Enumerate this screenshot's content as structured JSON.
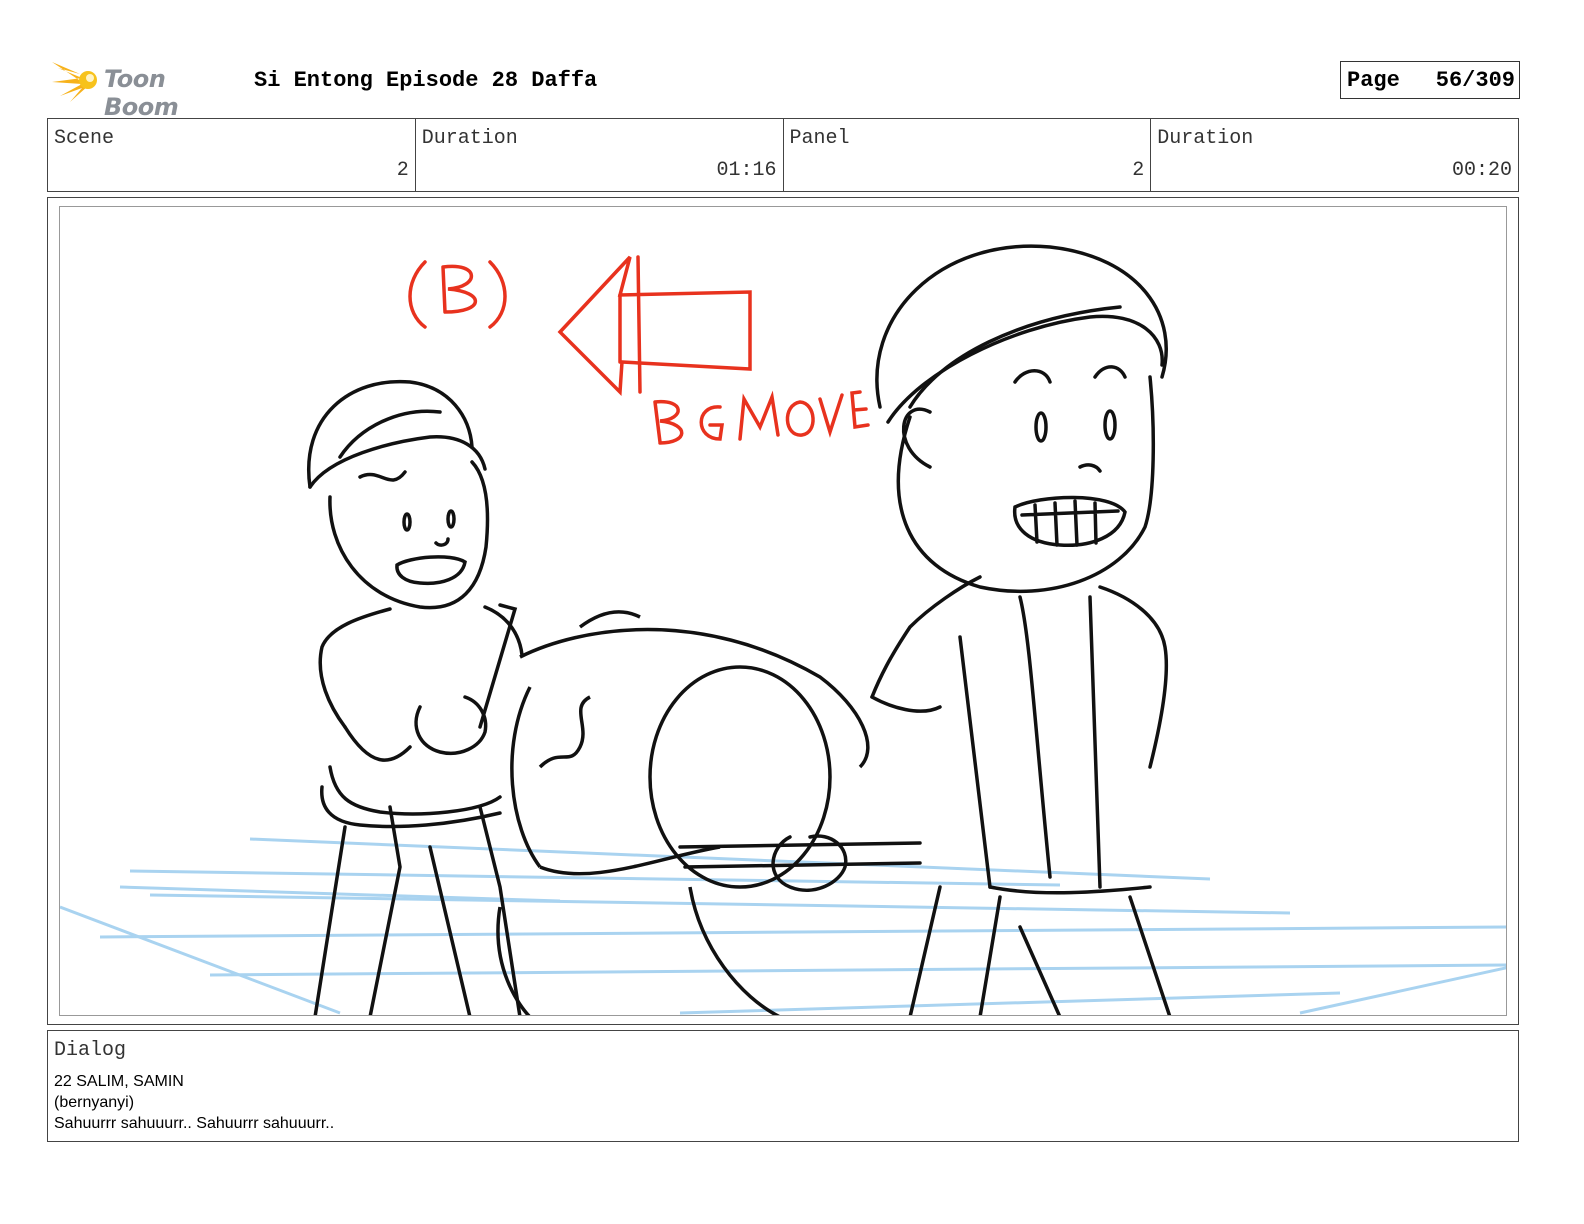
{
  "header": {
    "logo_text": "Toon Boom",
    "title": "Si Entong Episode 28 Daffa",
    "page_label": "Page",
    "page_value": "56/309"
  },
  "info": {
    "scene_label": "Scene",
    "scene_value": "2",
    "scene_duration_label": "Duration",
    "scene_duration_value": "01:16",
    "panel_label": "Panel",
    "panel_value": "2",
    "panel_duration_label": "Duration",
    "panel_duration_value": "00:20"
  },
  "sketch": {
    "annotation_letter": "(B)",
    "annotation_text": "BG MOVE",
    "annotation_color": "#e8321e",
    "guide_color": "#a9d3f0"
  },
  "dialog": {
    "label": "Dialog",
    "lines": [
      "22 SALIM, SAMIN",
      "(bernyanyi)",
      "Sahuurrr sahuuurr.. Sahuurrr sahuuurr.."
    ]
  }
}
